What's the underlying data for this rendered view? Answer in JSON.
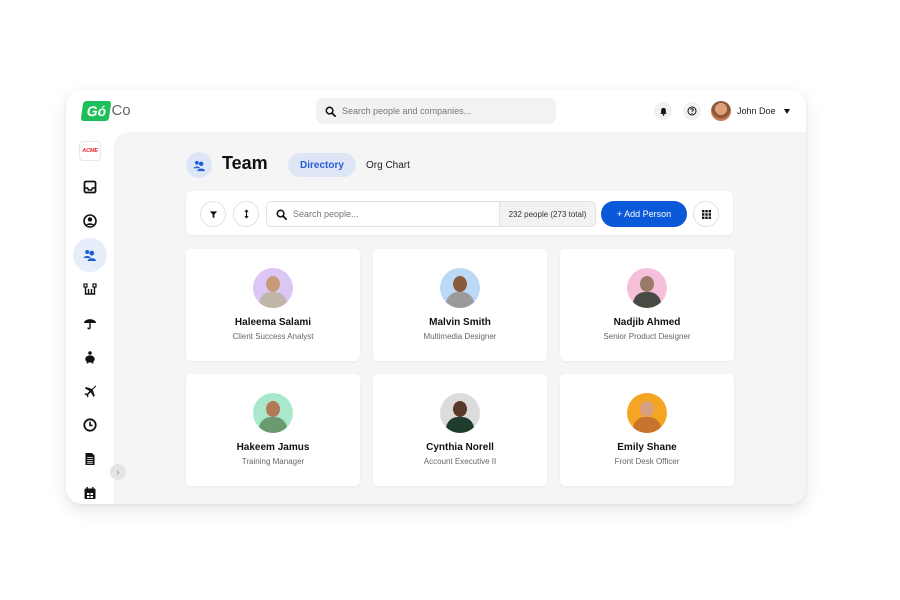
{
  "app": {
    "logo_badge": "Gó",
    "logo_suffix": "Co",
    "brand_color": "#1dbf5a",
    "accent_color": "#0b58d8"
  },
  "header": {
    "search_placeholder": "Search people and companies...",
    "notifications_icon": "bell-icon",
    "help_icon": "question-circle-icon",
    "user_name": "John Doe"
  },
  "sidebar": {
    "company_logo": "ACME",
    "items": [
      {
        "name": "inbox",
        "icon": "inbox-icon",
        "active": false
      },
      {
        "name": "profile",
        "icon": "user-circle-icon",
        "active": false
      },
      {
        "name": "team",
        "icon": "users-icon",
        "active": true
      },
      {
        "name": "org",
        "icon": "org-tree-icon",
        "active": false
      },
      {
        "name": "benefits",
        "icon": "umbrella-icon",
        "active": false
      },
      {
        "name": "payroll",
        "icon": "piggy-bank-icon",
        "active": false
      },
      {
        "name": "time-off",
        "icon": "plane-icon",
        "active": false
      },
      {
        "name": "time-tracking",
        "icon": "clock-icon",
        "active": false
      },
      {
        "name": "documents",
        "icon": "document-icon",
        "active": false
      },
      {
        "name": "calendar",
        "icon": "calendar-icon",
        "active": false
      }
    ]
  },
  "page": {
    "title": "Team",
    "tabs": [
      {
        "label": "Directory",
        "active": true
      },
      {
        "label": "Org Chart",
        "active": false
      }
    ]
  },
  "toolbar": {
    "filter_icon": "filter-icon",
    "sort_icon": "sort-icon",
    "search_placeholder": "Search people...",
    "count_text": "232 people (273 total)",
    "add_label": "+ Add Person",
    "view_icon": "grid-icon"
  },
  "people": [
    {
      "name": "Haleema Salami",
      "role": "Client Success Analyst",
      "avatar_bg": "#dcc6f5"
    },
    {
      "name": "Malvin Smith",
      "role": "Multimedia Designer",
      "avatar_bg": "#bcd8f7"
    },
    {
      "name": "Nadjib Ahmed",
      "role": "Senior Product Designer",
      "avatar_bg": "#f7c0da"
    },
    {
      "name": "Hakeem Jamus",
      "role": "Training Manager",
      "avatar_bg": "#a9e8cb"
    },
    {
      "name": "Cynthia Norell",
      "role": "Account Executive II",
      "avatar_bg": "#dcdcdc"
    },
    {
      "name": "Emily Shane",
      "role": "Front Desk Officer",
      "avatar_bg": "#f5a524"
    }
  ]
}
